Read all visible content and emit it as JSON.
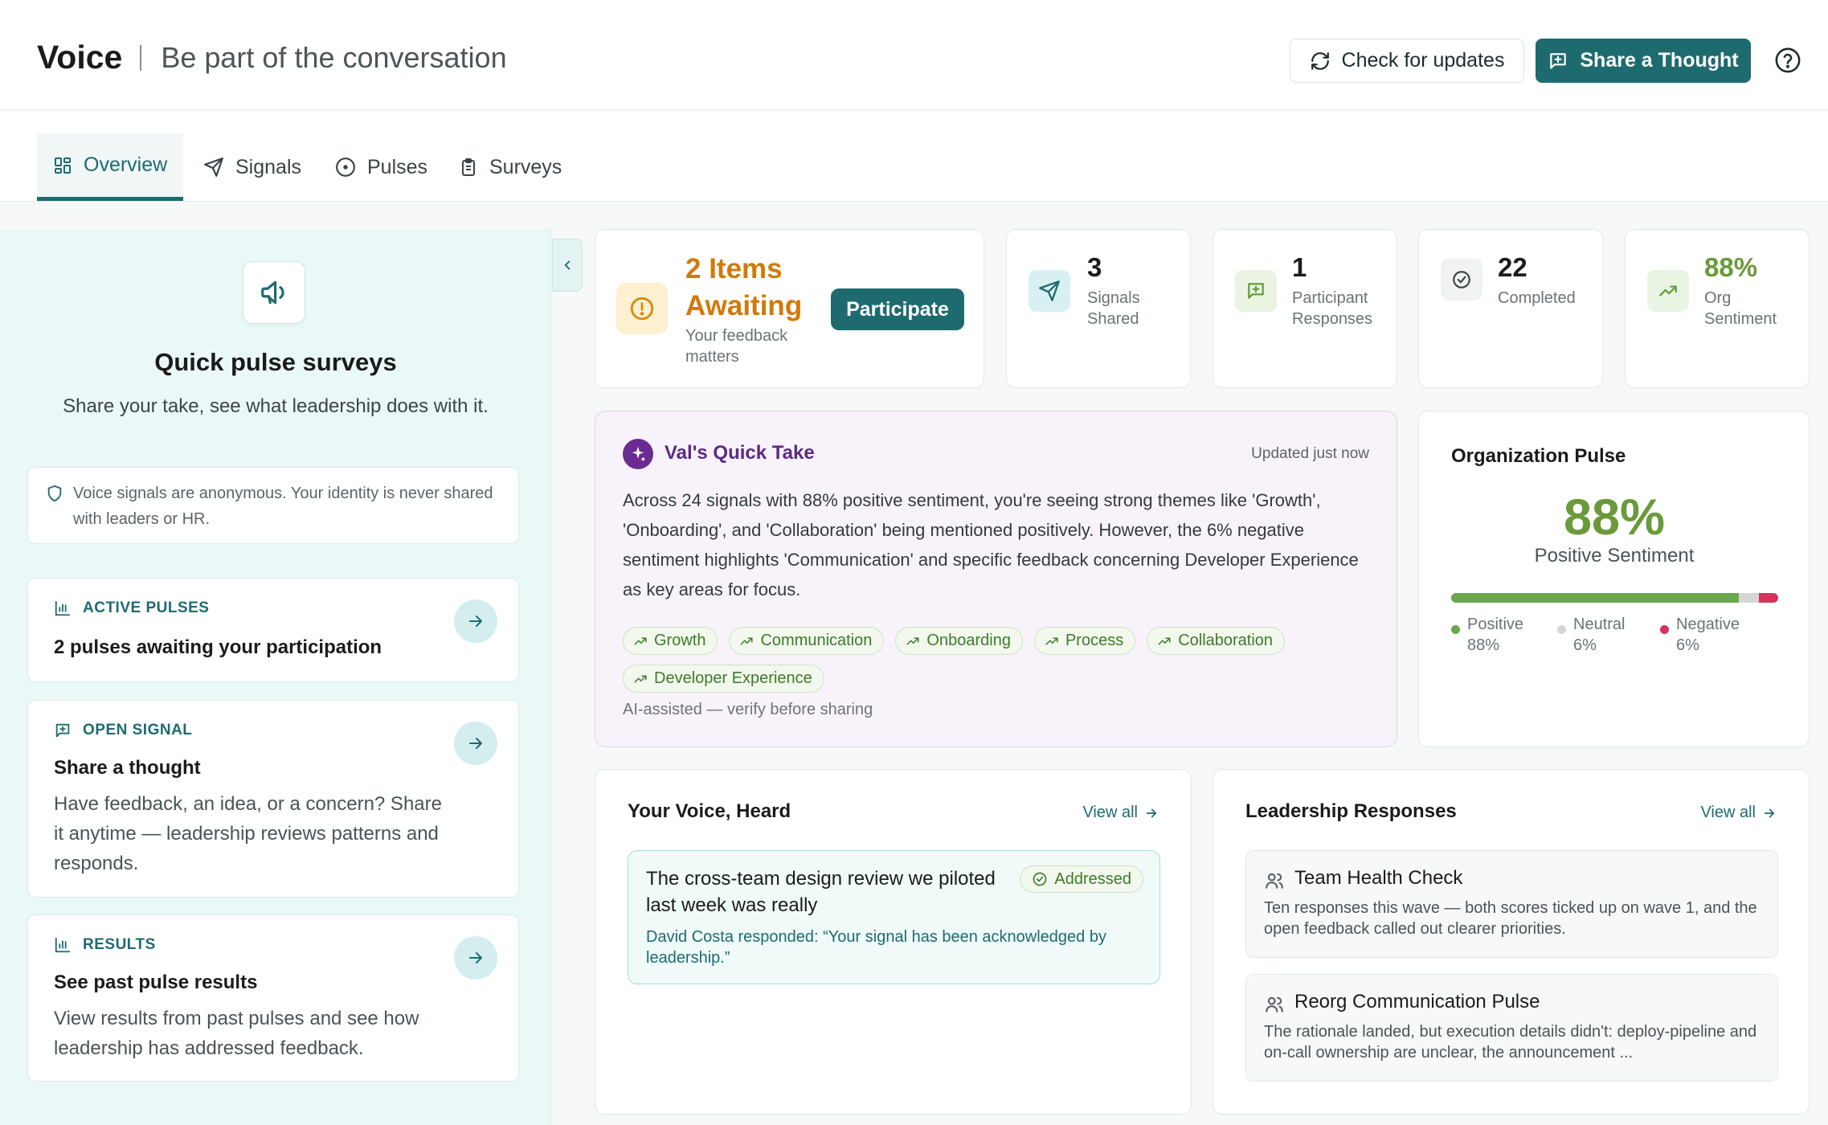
{
  "header": {
    "brand": "Voice",
    "tagline": "Be part of the conversation",
    "check_updates": "Check for updates",
    "share_thought": "Share a Thought"
  },
  "tabs": [
    {
      "label": "Overview",
      "icon": "grid-icon",
      "active": true
    },
    {
      "label": "Signals",
      "icon": "send-icon"
    },
    {
      "label": "Pulses",
      "icon": "target-icon"
    },
    {
      "label": "Surveys",
      "icon": "clipboard-icon"
    }
  ],
  "left": {
    "title": "Quick pulse surveys",
    "subtitle": "Share your take, see what leadership does with it.",
    "anon_notice": "Voice signals are anonymous. Your identity is never shared with leaders or HR.",
    "cards": [
      {
        "kicker": "ACTIVE PULSES",
        "title": "2 pulses awaiting your participation",
        "desc": ""
      },
      {
        "kicker": "OPEN SIGNAL",
        "title": "Share a thought",
        "desc": "Have feedback, an idea, or a concern? Share it anytime — leadership reviews patterns and responds."
      },
      {
        "kicker": "RESULTS",
        "title": "See past pulse results",
        "desc": "View results from past pulses and see how leadership has addressed feedback."
      }
    ]
  },
  "stats": {
    "awaiting": {
      "title": "2 Items Awaiting",
      "sub": "Your feedback matters",
      "button": "Participate"
    },
    "signals": {
      "num": "3",
      "label": "Signals Shared"
    },
    "responses": {
      "num": "1",
      "label": "Participant Responses"
    },
    "completed": {
      "num": "22",
      "label": "Completed"
    },
    "sentiment": {
      "num": "88%",
      "label": "Org Sentiment"
    }
  },
  "val": {
    "title": "Val's Quick Take",
    "updated": "Updated just now",
    "body": "Across 24 signals with 88% positive sentiment, you're seeing strong themes like 'Growth', 'Onboarding', and 'Collaboration' being mentioned positively. However, the 6% negative sentiment highlights 'Communication' and specific feedback concerning Developer Experience as key areas for focus.",
    "tags": [
      "Growth",
      "Communication",
      "Onboarding",
      "Process",
      "Collaboration",
      "Developer Experience"
    ],
    "note": "AI-assisted — verify before sharing"
  },
  "org_pulse": {
    "title": "Organization Pulse",
    "pct": "88%",
    "sub": "Positive Sentiment",
    "positive": {
      "label": "Positive",
      "value": "88%",
      "fraction": 0.88
    },
    "neutral": {
      "label": "Neutral",
      "value": "6%",
      "fraction": 0.06
    },
    "negative": {
      "label": "Negative",
      "value": "6%",
      "fraction": 0.06
    },
    "colors": {
      "positive": "#6aa84f",
      "neutral": "#d6d6d6",
      "negative": "#d6335a"
    }
  },
  "voice_heard": {
    "title": "Your Voice, Heard",
    "view_all": "View all",
    "signal": {
      "text": "The cross-team design review we piloted last week was really",
      "status": "Addressed",
      "response": "David Costa responded: “Your signal has been acknowledged by leadership.”"
    }
  },
  "leadership": {
    "title": "Leadership Responses",
    "view_all": "View all",
    "items": [
      {
        "title": "Team Health Check",
        "desc": "Ten responses this wave — both scores ticked up on wave 1, and the open feedback called out clearer priorities."
      },
      {
        "title": "Reorg Communication Pulse",
        "desc": "The rationale landed, but execution details didn't: deploy-pipeline and on-call ownership are unclear, the announcement ..."
      }
    ]
  }
}
